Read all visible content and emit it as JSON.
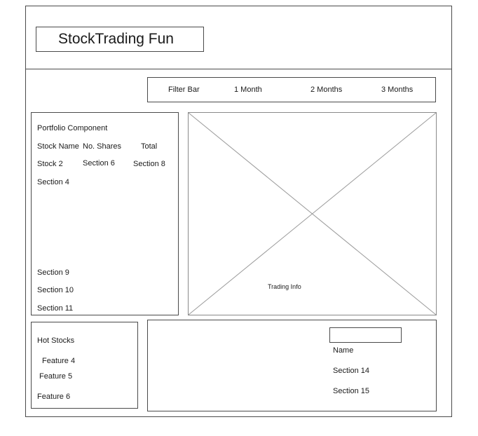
{
  "header": {
    "title": "StockTrading Fun"
  },
  "filter_bar": {
    "label": "Filter Bar",
    "options": [
      "1 Month",
      "2 Months",
      "3 Months"
    ]
  },
  "portfolio": {
    "title": "Portfolio Component",
    "columns": [
      "Stock Name",
      "No. Shares",
      "Total"
    ],
    "row": [
      "Stock 2",
      "Section 6",
      "Section 8"
    ],
    "section_4": "Section 4",
    "lower_sections": [
      "Section 9",
      "Section 10",
      "Section 11"
    ]
  },
  "chart": {
    "label": "Trading Info"
  },
  "hot_stocks": {
    "title": "Hot Stocks",
    "features": [
      "Feature 4",
      "Feature 5",
      "Feature 6"
    ]
  },
  "bottom_panel": {
    "input_value": "",
    "name_label": "Name",
    "sections": [
      "Section 14",
      "Section 15"
    ]
  }
}
